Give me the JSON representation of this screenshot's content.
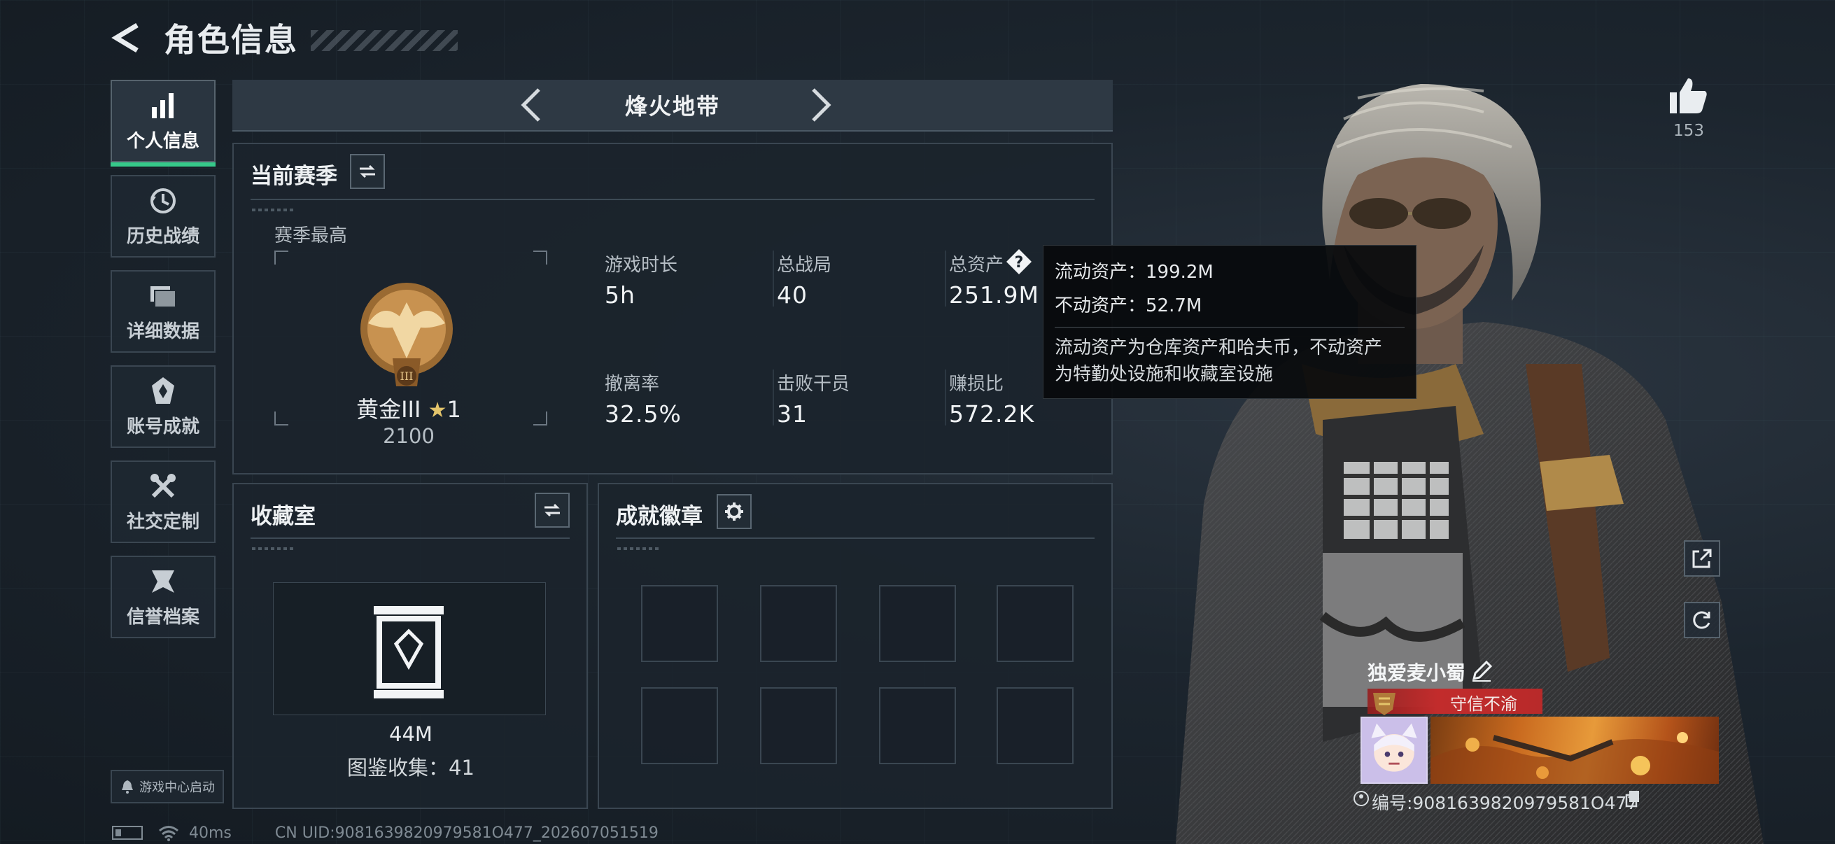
{
  "header": {
    "title": "角色信息"
  },
  "sidebar": {
    "items": [
      {
        "label": "个人信息",
        "icon": "bar-chart-icon",
        "active": true
      },
      {
        "label": "历史战绩",
        "icon": "history-clock-icon"
      },
      {
        "label": "详细数据",
        "icon": "folder-icon"
      },
      {
        "label": "账号成就",
        "icon": "achievement-icon"
      },
      {
        "label": "社交定制",
        "icon": "tools-icon"
      },
      {
        "label": "信誉档案",
        "icon": "reputation-icon"
      }
    ],
    "launch_label": "游戏中心启动"
  },
  "mode": {
    "name": "烽火地带"
  },
  "season": {
    "title": "当前赛季",
    "best_label": "赛季最高",
    "rank_name": "黄金III",
    "rank_stars": "1",
    "rank_score": "2100",
    "stats": [
      {
        "label": "游戏时长",
        "value": "5h"
      },
      {
        "label": "总战局",
        "value": "40"
      },
      {
        "label": "总资产",
        "value": "251.9M"
      },
      {
        "label": "撤离率",
        "value": "32.5%"
      },
      {
        "label": "击败干员",
        "value": "31"
      },
      {
        "label": "赚损比",
        "value": "572.2K"
      }
    ]
  },
  "tooltip": {
    "liquid": "流动资产：199.2M",
    "fixed": "不动资产：52.7M",
    "desc_line1": "流动资产为仓库资产和哈夫币，不动资产",
    "desc_line2": "为特勤处设施和收藏室设施"
  },
  "collection": {
    "title": "收藏室",
    "value": "44M",
    "count": "图鉴收集：41"
  },
  "badges": {
    "title": "成就徽章",
    "slots": 8
  },
  "profile": {
    "likes": "153",
    "player_name": "独爱麦小蜀",
    "reputation": "守信不渝",
    "player_id": "编号:9081639820979581O477"
  },
  "status": {
    "ping": "40ms",
    "uid": "CN UID:9081639820979581O477_202607051519"
  },
  "colors": {
    "accent": "#36c98a",
    "reputation": "#c22c2c",
    "gold": "#e3c46b"
  }
}
